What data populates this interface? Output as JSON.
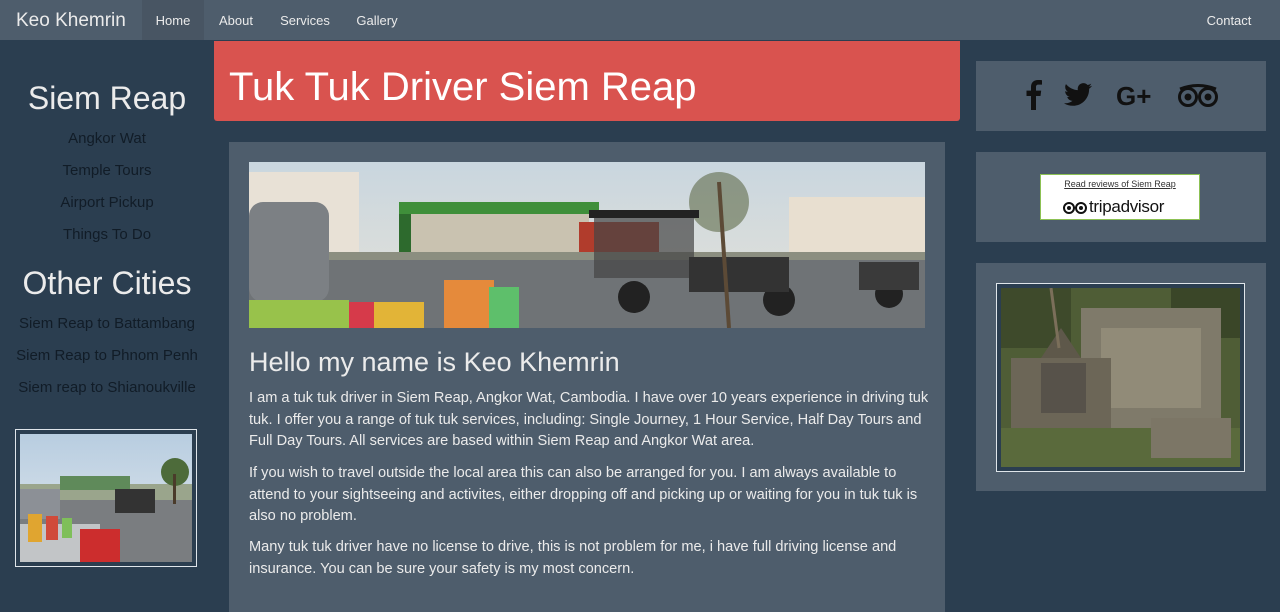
{
  "navbar": {
    "brand": "Keo Khemrin",
    "items": [
      {
        "label": "Home"
      },
      {
        "label": "About"
      },
      {
        "label": "Services"
      },
      {
        "label": "Gallery"
      }
    ],
    "contact": "Contact"
  },
  "sidebar": {
    "heading1": "Siem Reap",
    "links1": [
      "Angkor Wat",
      "Temple Tours",
      "Airport Pickup",
      "Things To Do"
    ],
    "heading2": "Other Cities",
    "links2": [
      "Siem Reap to Battambang",
      "Siem Reap to Phnom Penh",
      "Siem reap to Shianoukville"
    ]
  },
  "hero": {
    "title": "Tuk Tuk Driver Siem Reap"
  },
  "main": {
    "heading": "Hello my name is Keo Khemrin",
    "paragraphs": [
      "I am a tuk tuk driver in Siem Reap, Angkor Wat, Cambodia. I have over 10 years experience in driving tuk tuk. I offer you a range of tuk tuk services, including: Single Journey, 1 Hour Service, Half Day Tours and Full Day Tours. All services are based within Siem Reap and Angkor Wat area.",
      "If you wish to travel outside the local area this can also be arranged for you. I am always available to attend to your sightseeing and activites, either dropping off and picking up or waiting for you in tuk tuk is also no problem.",
      "Many tuk tuk driver have no license to drive, this is not problem for me, i have full driving license and insurance. You can be sure your safety is my most concern."
    ]
  },
  "social": {
    "icons": [
      "facebook-icon",
      "twitter-icon",
      "google-plus-icon",
      "tripadvisor-icon"
    ]
  },
  "tripadvisor_badge": {
    "link_text": "Read reviews of Siem Reap",
    "logo_text": "tripadvisor"
  },
  "colors": {
    "background": "#2b3e50",
    "panel": "#4e5d6c",
    "hero": "#d9534f",
    "link": "#111c27"
  }
}
